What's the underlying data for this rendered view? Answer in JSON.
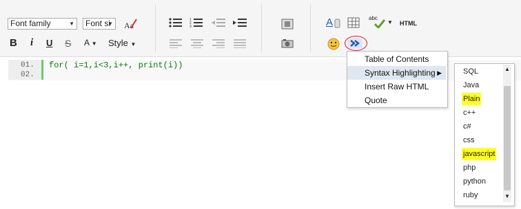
{
  "toolbar": {
    "font_family": "Font family",
    "font_size": "Font si",
    "style_label": "Style",
    "html_label": "HTML",
    "spell_label": "abc",
    "text_color_label": "A",
    "bold": "B",
    "italic": "i",
    "underline": "U",
    "strike": "S",
    "font_color": "A"
  },
  "editor": {
    "line_numbers": [
      "01.",
      "02."
    ],
    "code": "for( i=1,i<3,i++, print(i))"
  },
  "menu": {
    "items": [
      "Table of Contents",
      "Syntax Highlighting",
      "Insert Raw HTML",
      "Quote"
    ],
    "active_index": 1
  },
  "submenu": {
    "items": [
      "SQL",
      "Java",
      "Plain",
      "c++",
      "c#",
      "css",
      "javascript",
      "php",
      "python",
      "ruby"
    ],
    "highlighted": [
      "Plain",
      "javascript"
    ],
    "highlight_color": "#ffff20"
  },
  "annotation_color": "#ee1111"
}
